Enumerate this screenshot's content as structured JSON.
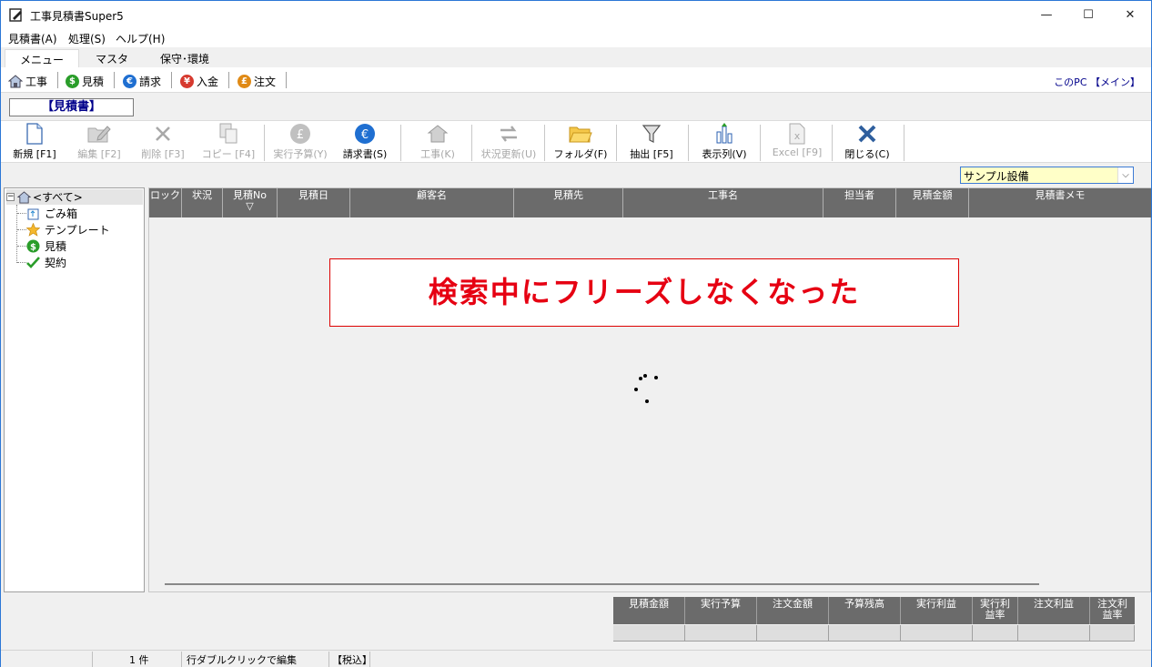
{
  "window": {
    "title": "工事見積書Super5",
    "controls": {
      "minimize": "—",
      "maximize": "☐",
      "close": "✕"
    }
  },
  "menubar": [
    "見積書(A)",
    "処理(S)",
    "ヘルプ(H)"
  ],
  "tabs": [
    "メニュー",
    "マスタ",
    "保守･環境"
  ],
  "nav": {
    "items": [
      {
        "label": "工事",
        "icon": "house-icon"
      },
      {
        "label": "見積",
        "icon": "dollar-coin-icon",
        "color": "#2a9d2a",
        "symbol": "$"
      },
      {
        "label": "請求",
        "icon": "euro-coin-icon",
        "color": "#1f6fd1",
        "symbol": "€"
      },
      {
        "label": "入金",
        "icon": "yen-coin-icon",
        "color": "#d63a2f",
        "symbol": "¥"
      },
      {
        "label": "注文",
        "icon": "pound-coin-icon",
        "color": "#e08a16",
        "symbol": "£"
      }
    ],
    "location": "このPC 【メイン】"
  },
  "section_title": "【見積書】",
  "toolbar": [
    {
      "label": "新規 [F1]",
      "icon": "new-document-icon",
      "enabled": true
    },
    {
      "label": "編集 [F2]",
      "icon": "edit-folder-icon",
      "enabled": false
    },
    {
      "label": "削除 [F3]",
      "icon": "delete-x-icon",
      "enabled": false
    },
    {
      "label": "コピー [F4]",
      "icon": "copy-icon",
      "enabled": false
    },
    {
      "label": "実行予算(Y)",
      "icon": "pound-coin-icon",
      "enabled": false
    },
    {
      "label": "請求書(S)",
      "icon": "euro-coin-icon",
      "enabled": true
    },
    {
      "label": "工事(K)",
      "icon": "house-icon",
      "enabled": false
    },
    {
      "label": "状況更新(U)",
      "icon": "refresh-arrows-icon",
      "enabled": false
    },
    {
      "label": "フォルダ(F)",
      "icon": "folder-icon",
      "enabled": true
    },
    {
      "label": "抽出 [F5]",
      "icon": "filter-funnel-icon",
      "enabled": true
    },
    {
      "label": "表示列(V)",
      "icon": "columns-chart-icon",
      "enabled": true
    },
    {
      "label": "Excel [F9]",
      "icon": "excel-icon",
      "enabled": false
    },
    {
      "label": "閉じる(C)",
      "icon": "close-x-icon",
      "enabled": true
    }
  ],
  "company_select": {
    "value": "サンプル設備",
    "arrow": "⌵"
  },
  "tree": {
    "expander": "−",
    "root": "<すべて>",
    "children": [
      {
        "label": "ごみ箱",
        "icon": "recycle-bin-icon"
      },
      {
        "label": "テンプレート",
        "icon": "star-icon"
      },
      {
        "label": "見積",
        "icon": "dollar-coin-icon"
      },
      {
        "label": "契約",
        "icon": "checkmark-icon"
      }
    ]
  },
  "grid": {
    "columns": [
      "ロック",
      "状況",
      "見積No",
      "見積日",
      "顧客名",
      "見積先",
      "工事名",
      "担当者",
      "見積金額",
      "見積書メモ"
    ],
    "sort_indicator": "▽"
  },
  "banner": "検索中にフリーズしなくなった",
  "summary": {
    "headers": [
      "見積金額",
      "実行予算",
      "注文金額",
      "予算残高",
      "実行利益",
      "実行利\n益率",
      "注文利益",
      "注文利\n益率"
    ]
  },
  "status": {
    "count": "1 件",
    "hint": "行ダブルクリックで編集",
    "tax": "【税込】"
  }
}
